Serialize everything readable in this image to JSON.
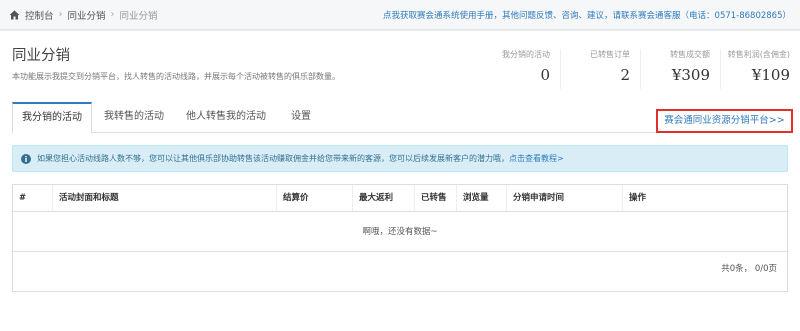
{
  "breadcrumb": {
    "items": [
      "控制台",
      "同业分销",
      "同业分销"
    ]
  },
  "topbar": {
    "help_text": "点我获取赛会通系统使用手册，其他问题反馈、咨询、建议，请联系赛会通客服（电话：0571-86802865）"
  },
  "header": {
    "title": "同业分销",
    "description": "本功能展示我提交到分销平台，找人转售的活动线路，并展示每个活动被转售的俱乐部数量。"
  },
  "stats": [
    {
      "label": "我分销的活动",
      "value": "0"
    },
    {
      "label": "已转售订单",
      "value": "2"
    },
    {
      "label": "转售成交额",
      "value": "¥309"
    },
    {
      "label": "转售利润(含佣金)",
      "value": "¥109"
    }
  ],
  "tabs": [
    {
      "label": "我分销的活动",
      "active": true
    },
    {
      "label": "我转售的活动",
      "active": false
    },
    {
      "label": "他人转售我的活动",
      "active": false
    },
    {
      "label": "设置",
      "active": false
    }
  ],
  "platform_link": "赛会通同业资源分销平台>>",
  "alert": {
    "text": "如果您担心活动线路人数不够，您可以让其他俱乐部协助转售该活动赚取佣金并给您带来新的客源，您可以后续发展新客户的潜力哦，",
    "link": "点击查看教程>"
  },
  "table": {
    "columns": [
      "#",
      "活动封面和标题",
      "结算价",
      "最大返利",
      "已转售",
      "浏览量",
      "分销申请时间",
      "操作"
    ],
    "empty_text": "啊哦，还没有数据~",
    "pager": "共0条， 0/0页"
  },
  "colors": {
    "accent": "#2e7bbd",
    "highlight_border": "#e0302b",
    "alert_bg": "#d9edf7"
  }
}
